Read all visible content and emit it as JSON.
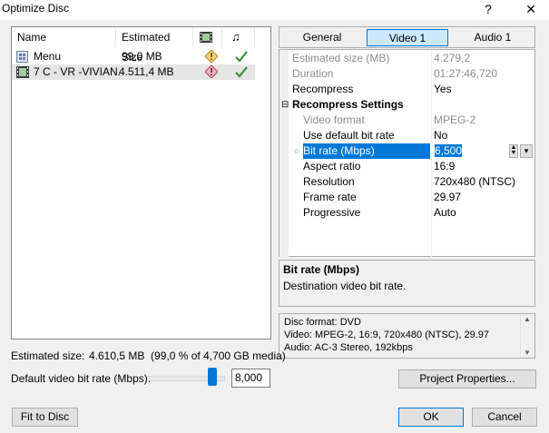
{
  "window": {
    "title": "Optimize Disc",
    "help_label": "?",
    "close_label": "✕"
  },
  "list": {
    "headers": {
      "name": "Name",
      "size": "Estimated Size"
    },
    "rows": [
      {
        "name": "Menu",
        "size": "99,0 MB"
      },
      {
        "name": "7 C - VR -VIVIAN...",
        "size": "4.511,4 MB"
      }
    ]
  },
  "tabs": [
    {
      "label": "General"
    },
    {
      "label": "Video 1"
    },
    {
      "label": "Audio 1"
    }
  ],
  "properties": {
    "rows": [
      {
        "name": "Estimated size (MB)",
        "value": "4.279,2"
      },
      {
        "name": "Duration",
        "value": "01:27:46,720"
      },
      {
        "name": "Recompress",
        "value": "Yes"
      }
    ],
    "section_title": "Recompress Settings",
    "section_rows": [
      {
        "name": "Video format",
        "value": "MPEG-2"
      },
      {
        "name": "Use default bit rate",
        "value": "No"
      },
      {
        "name": "Bit rate (Mbps)",
        "value": "6,500"
      },
      {
        "name": "Aspect ratio",
        "value": "16:9"
      },
      {
        "name": "Resolution",
        "value": "720x480 (NTSC)"
      },
      {
        "name": "Frame rate",
        "value": "29.97"
      },
      {
        "name": "Progressive",
        "value": "Auto"
      }
    ]
  },
  "help": {
    "title": "Bit rate (Mbps)",
    "text": "Destination video bit rate."
  },
  "info": {
    "line1": "Disc format:  DVD",
    "line2": "Video:  MPEG-2, 16:9, 720x480 (NTSC), 29.97",
    "line3": "Audio:  AC-3 Stereo, 192kbps"
  },
  "footer": {
    "estimated_label": "Estimated size:",
    "estimated_value": "4.610,5 MB  (99,0 % of 4,700 GB media)",
    "bitrate_label": "Default video bit rate (Mbps):",
    "bitrate_value": "8,000",
    "bitrate_slider_level": 0.9,
    "project_properties": "Project Properties...",
    "fit_to_disc": "Fit to Disc",
    "ok": "OK",
    "cancel": "Cancel"
  }
}
